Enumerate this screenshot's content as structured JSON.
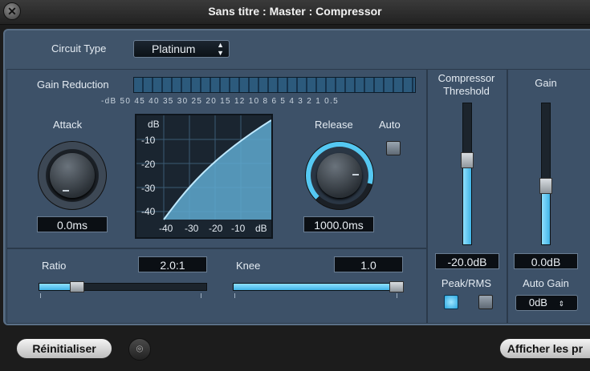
{
  "window": {
    "title": "Sans titre : Master : Compressor"
  },
  "icons": {
    "close": "close-icon",
    "link": "link-icon"
  },
  "circuit": {
    "label": "Circuit Type",
    "value": "Platinum"
  },
  "gain_reduction": {
    "label": "Gain Reduction",
    "scale": "-dB  50 45 40 35 30 25 20 15 12 10 8  6  5  4  3  2  1  0.5"
  },
  "attack": {
    "label": "Attack",
    "value": "0.0ms"
  },
  "release": {
    "label": "Release",
    "value": "1000.0ms"
  },
  "auto": {
    "label": "Auto",
    "checked": false
  },
  "graph": {
    "y_unit": "dB",
    "y_ticks": [
      "-10",
      "-20",
      "-30",
      "-40"
    ],
    "x_ticks": [
      "-40",
      "-30",
      "-20",
      "-10",
      "dB"
    ]
  },
  "ratio": {
    "label": "Ratio",
    "value": "2.0:1",
    "level": 0.2
  },
  "knee": {
    "label": "Knee",
    "value": "1.0",
    "level": 1.0
  },
  "threshold": {
    "label_line1": "Compressor",
    "label_line2": "Threshold",
    "value": "-20.0dB",
    "level": 0.6
  },
  "gain": {
    "label": "Gain",
    "value": "0.0dB",
    "level": 0.4
  },
  "peak_rms": {
    "label": "Peak/RMS",
    "peak_selected": true
  },
  "auto_gain": {
    "label": "Auto Gain",
    "value": "0dB"
  },
  "footer": {
    "reset_label": "Réinitialiser",
    "show_label": "Afficher les pr"
  },
  "colors": {
    "accent": "#55c8f2",
    "panel": "#40546a"
  }
}
